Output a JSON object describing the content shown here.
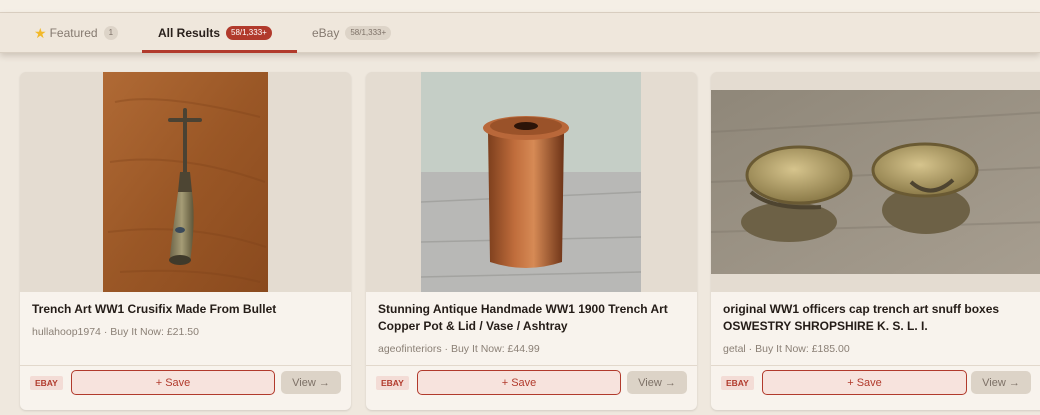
{
  "tabs": [
    {
      "label": "Featured",
      "count": "1",
      "icon": "star-icon"
    },
    {
      "label": "All Results",
      "count": "58/1,333+",
      "active": true
    },
    {
      "label": "eBay",
      "count": "58/1,333+"
    }
  ],
  "listings": [
    {
      "title": "Trench Art WW1 Crusifix Made From Bullet",
      "meta": "hullahoop1974 · Buy It Now: £21.50",
      "source": "EBAY",
      "save_label": "+ Save",
      "view_label": "View →"
    },
    {
      "title": "Stunning Antique Handmade WW1 1900 Trench Art Copper Pot & Lid / Vase / Ashtray",
      "meta": "ageofinteriors · Buy It Now: £44.99",
      "source": "EBAY",
      "save_label": "+ Save",
      "view_label": "View →"
    },
    {
      "title": "original WW1 officers cap trench art snuff boxes OSWESTRY SHROPSHIRE K. S. L. I.",
      "meta": "getal · Buy It Now: £185.00",
      "source": "EBAY",
      "save_label": "+ Save",
      "view_label": "View →"
    }
  ],
  "colors": {
    "accent": "#b13a2c",
    "background": "#efe8de",
    "card": "#f8f3ed"
  }
}
